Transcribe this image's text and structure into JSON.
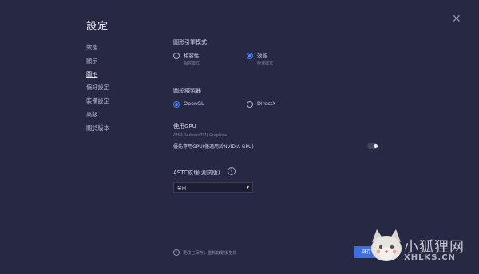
{
  "window": {
    "title": "設定"
  },
  "sidebar": {
    "items": [
      {
        "label": "效能"
      },
      {
        "label": "顯示"
      },
      {
        "label": "圖形"
      },
      {
        "label": "偏好設定"
      },
      {
        "label": "裝備設定"
      },
      {
        "label": "高級"
      },
      {
        "label": "關於版本"
      }
    ]
  },
  "graphics_engine": {
    "title": "圖形引擎模式",
    "options": [
      {
        "label": "相容性",
        "sub": "相容模式"
      },
      {
        "label": "效能",
        "sub": "極速模式"
      }
    ]
  },
  "renderer": {
    "title": "圖形繪製器",
    "options": [
      {
        "label": "OpenGL"
      },
      {
        "label": "DirectX"
      }
    ]
  },
  "gpu": {
    "title": "使用GPU",
    "name": "AMD Radeon(TM) Graphics",
    "toggle_label": "優先專用GPU(僅適用於NVIDIA GPU)"
  },
  "astc": {
    "title": "ASTC紋理(測試版)",
    "help_icon": "?",
    "select_value": "禁用"
  },
  "footer": {
    "info_icon": "i",
    "note": "更改已保存，重新啟動後生效",
    "save_label": "儲存"
  },
  "watermark": {
    "text": "小狐狸网",
    "sub": "XHLKS.CN"
  }
}
